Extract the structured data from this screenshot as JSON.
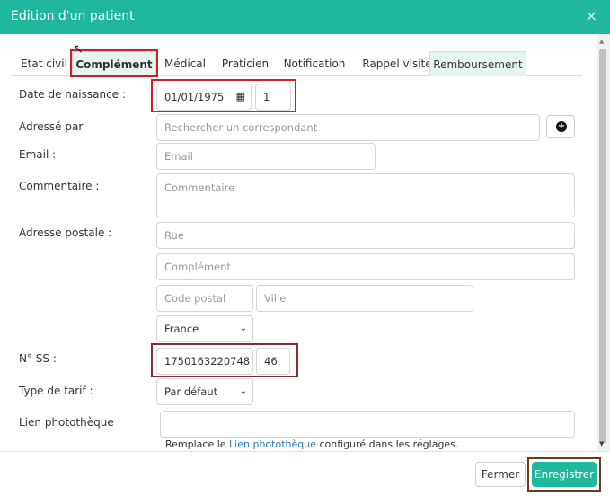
{
  "dialog": {
    "title": "Edition d'un patient",
    "close_glyph": "×"
  },
  "tabs": [
    {
      "label": "Etat civil"
    },
    {
      "label": "Complément"
    },
    {
      "label": "Médical"
    },
    {
      "label": "Praticien"
    },
    {
      "label": "Notification"
    },
    {
      "label": "Rappel visite"
    },
    {
      "label": "Remboursement"
    }
  ],
  "active_tab": "Complément",
  "form": {
    "birth_date": {
      "label": "Date de naissance :",
      "value": "01/01/1975",
      "rank_value": "1"
    },
    "referred_by": {
      "label": "Adressé par",
      "placeholder": "Rechercher un correspondant"
    },
    "email": {
      "label": "Email :",
      "placeholder": "Email"
    },
    "comment": {
      "label": "Commentaire :",
      "placeholder": "Commentaire"
    },
    "address": {
      "label": "Adresse postale :",
      "street_placeholder": "Rue",
      "complement_placeholder": "Complément",
      "postal_placeholder": "Code postal",
      "city_placeholder": "Ville",
      "country_value": "France"
    },
    "ssn": {
      "label": "N° SS :",
      "value": "1750163220748",
      "key_value": "46"
    },
    "tariff": {
      "label": "Type de tarif :",
      "value": "Par défaut"
    },
    "photo_link": {
      "label": "Lien photothèque",
      "hint_prefix": "Remplace le ",
      "hint_link": "Lien photothèque",
      "hint_suffix": " configuré dans les réglages."
    }
  },
  "footer": {
    "close_label": "Fermer",
    "save_label": "Enregistrer"
  },
  "colors": {
    "brand": "#1fb89c",
    "highlight_red": "#cc1f2a",
    "highlight_brown": "#8b2d2d"
  }
}
